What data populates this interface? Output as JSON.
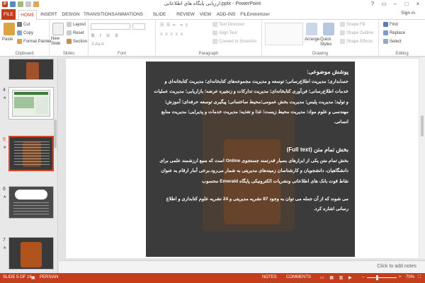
{
  "window": {
    "title": "ارزیابی پایگاه های اطلاعاتی.pptx - PowerPoint",
    "controls": [
      "?",
      "▭",
      "–",
      "□",
      "×"
    ],
    "sign_in": "Sign in"
  },
  "tabs": [
    "FILE",
    "HOME",
    "INSERT",
    "DESIGN",
    "TRANSITIONS",
    "ANIMATIONS",
    "SLIDE SHOW",
    "REVIEW",
    "VIEW",
    "ADD-INS",
    "FILEminimizer"
  ],
  "active_tab": "HOME",
  "ribbon": {
    "clipboard": {
      "label": "Clipboard",
      "paste": "Paste",
      "cut": "Cut",
      "copy": "Copy",
      "format_painter": "Format Painter"
    },
    "slides": {
      "label": "Slides",
      "new_slide": "New Slide",
      "layout": "Layout",
      "reset": "Reset",
      "section": "Section"
    },
    "font": {
      "label": "Font"
    },
    "paragraph": {
      "label": "Paragraph",
      "text_direction": "Text Direction",
      "align_text": "Align Text",
      "smartart": "Convert to SmartArt"
    },
    "drawing": {
      "label": "Drawing",
      "arrange": "Arrange",
      "quick_styles": "Quick Styles",
      "shape_fill": "Shape Fill",
      "shape_outline": "Shape Outline",
      "shape_effects": "Shape Effects"
    },
    "editing": {
      "label": "Editing",
      "find": "Find",
      "replace": "Replace",
      "select": "Select"
    }
  },
  "thumbnails": [
    {
      "num": "4",
      "star": "★"
    },
    {
      "num": "5",
      "star": "★"
    },
    {
      "num": "6",
      "star": "★"
    },
    {
      "num": "7",
      "star": "★"
    }
  ],
  "slide": {
    "heading1": "پوشش موضوعی:",
    "para1": "حسابداری؛ مدیریت اطلاع‌رسانی؛ توسعه و مدیریت مجموعه‌های کتابخانه‌ای؛ مدیریت کتابخانه‌ای و خدمات اطلاع‌رسانی؛ فن‌آوری کتابخانه‌ای؛ مدیریت تدارکات و زنجیره عرضه؛ بازاریابی؛ مدیریت عملیات و تولید؛ مدیریت پلیس؛ مدیریت بخش عمومی؛محیط ساختمانی؛ پیگیری توسعه حرفه‌ای؛ آموزش؛ مهندسی و علوم مواد؛ مدیریت محیط زیست؛ غذا و تغذیه؛ مدیریت خدمات و پذیرایی؛ مدیریت منابع انسانی.",
    "heading2": "بخش تمام متن (Full text)",
    "para2": "بخش تمام متن یکی از ابزارهای بسیار قدرتمند جستجوی Online است که منبع ارزشمند علمی برای دانشگاهیان، دانشجویان و کارشناسان زمینه‌های مدیریتی به شمار می‌رود.برخی آمار ارقام به عنوان نقاط قوت بانک های اطلاعاتی ونشریات الکترونیکی پایگاه Emerald محسوب",
    "para3": "می شوند که از آن جمله می توان به وجود 87 نشریه مدیریتی و 24 نشریه علوم کتابداری و اطلاع رسانی اشاره کرد."
  },
  "notes_placeholder": "Click to add notes",
  "status": {
    "slide_of": "SLIDE 5 OF 16",
    "language": "PERSIAN",
    "notes": "NOTES",
    "comments": "COMMENTS",
    "zoom": "70%",
    "plus": "+",
    "minus": "–"
  },
  "colors": {
    "accent": "#c43e1c",
    "slide_bg": "#3b3b3b"
  }
}
